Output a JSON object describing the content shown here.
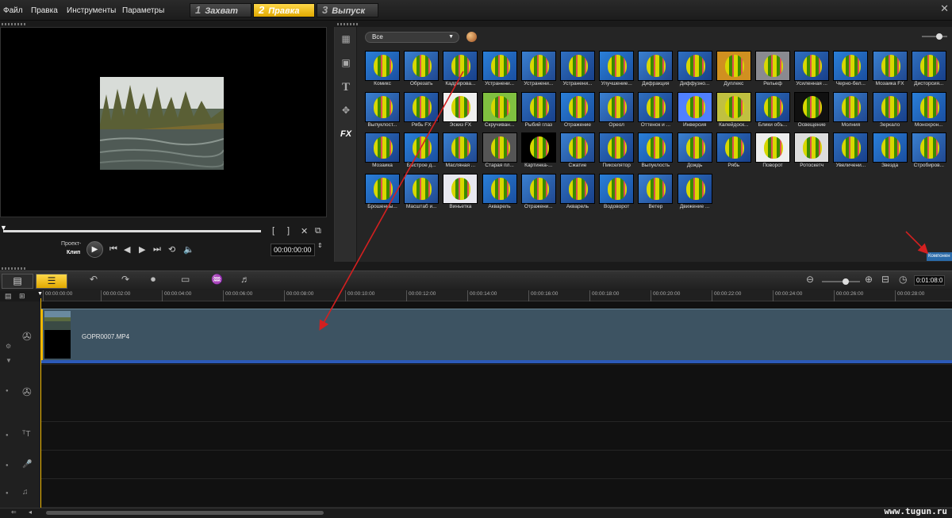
{
  "menu": {
    "items": [
      "Файл",
      "Правка",
      "Инструменты",
      "Параметры"
    ]
  },
  "steps": [
    {
      "num": "1",
      "label": "Захват"
    },
    {
      "num": "2",
      "label": "Правка"
    },
    {
      "num": "3",
      "label": "Выпуск"
    }
  ],
  "active_step": "2",
  "player": {
    "project_label": "Проект-",
    "clip_label": "Клип",
    "timecode": "00:00:00:00"
  },
  "library": {
    "filter_value": "Все",
    "compose_label": "Компонен",
    "effects": [
      "Комикс",
      "Обрезать",
      "Кадрирова...",
      "Устранени...",
      "Устранени...",
      "Устранени...",
      "Улучшение...",
      "Дифракция",
      "Диффузно...",
      "Дуплекс",
      "Рельеф",
      "Усиленная ...",
      "Черно-бел...",
      "Мозаика FX",
      "Дисторсия...",
      "Выпуклост...",
      "Рябь FX",
      "Эскиз FX",
      "Скручиван...",
      "Рыбий глаз",
      "Отражение",
      "Ореол",
      "Оттенок и ...",
      "Инверсия",
      "Калейдоск...",
      "Блики объ...",
      "Освещение",
      "Молния",
      "Зеркало",
      "Монохрон...",
      "Мозаика",
      "Быстрое д...",
      "Масляная ...",
      "Старая пл...",
      "Картинка-...",
      "Сжатие",
      "Пикселятор",
      "Выпуклость",
      "Дождь",
      "Рябь",
      "Поворот",
      "Ротоскетч",
      "Увеличени...",
      "Звезда",
      "Стробиров...",
      "Брошенны...",
      "Масштаб и...",
      "Виньетка",
      "Акварель",
      "Отражени...",
      "Акварель",
      "Водоворот",
      "Ветер",
      "Движение ..."
    ]
  },
  "timeline": {
    "timecode": "0:01:08:0",
    "start_time": "00:00:00:00",
    "ruler": [
      "00:00:02:00",
      "00:00:04:00",
      "00:00:06:00",
      "00:00:08:00",
      "00:00:10:00",
      "00:00:12:00",
      "00:00:14:00",
      "00:00:16:00",
      "00:00:18:00",
      "00:00:20:00",
      "00:00:22:00",
      "00:00:24:00",
      "00:00:26:00",
      "00:00:28:00"
    ],
    "clip_name": "GOPR0007.MP4"
  },
  "watermark": "www.tugun.ru",
  "colors": {
    "accent": "#f0b800",
    "clip": "#3d5362",
    "arrow": "#d42020"
  }
}
